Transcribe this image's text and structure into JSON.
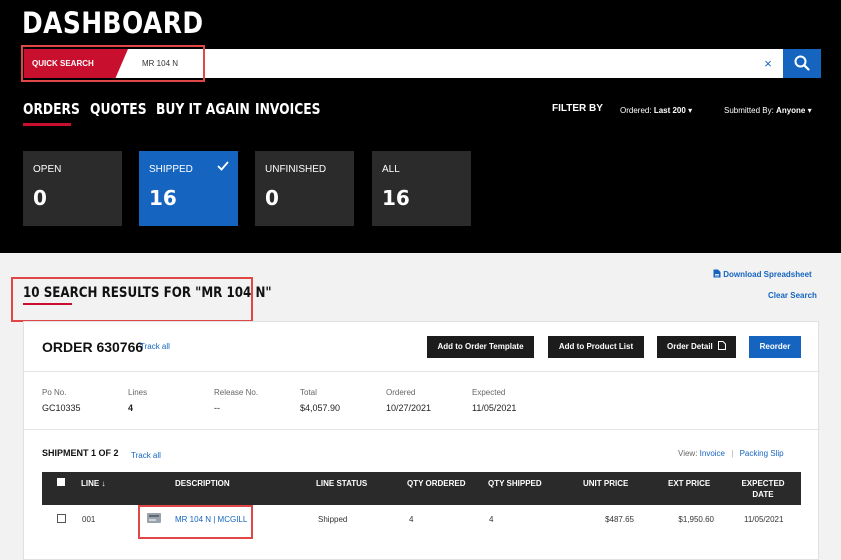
{
  "header": {
    "title": "DASHBOARD",
    "search": {
      "label": "QUICK SEARCH",
      "value": "MR 104 N",
      "clear_glyph": "×",
      "icon": "search-icon"
    }
  },
  "nav": {
    "tabs": [
      "ORDERS",
      "QUOTES",
      "BUY IT AGAIN",
      "INVOICES"
    ],
    "active": "ORDERS"
  },
  "filters": {
    "label": "FILTER BY",
    "ordered_label": "Ordered:",
    "ordered_value": "Last 200",
    "submitted_label": "Submitted By:",
    "submitted_value": "Anyone"
  },
  "status_cards": [
    {
      "label": "OPEN",
      "count": "0"
    },
    {
      "label": "SHIPPED",
      "count": "16",
      "active": true
    },
    {
      "label": "UNFINISHED",
      "count": "0"
    },
    {
      "label": "ALL",
      "count": "16"
    }
  ],
  "results": {
    "title": "10 SEARCH RESULTS FOR \"MR 104 N\"",
    "download_label": "Download Spreadsheet",
    "clear_label": "Clear Search"
  },
  "order": {
    "title": "ORDER 630766",
    "track_label": "Track all",
    "buttons": {
      "add_template": "Add to Order Template",
      "add_product_list": "Add to Product List",
      "order_detail": "Order Detail",
      "reorder": "Reorder"
    },
    "meta": [
      {
        "key": "Po No.",
        "value": "GC10335"
      },
      {
        "key": "Lines",
        "value": "4"
      },
      {
        "key": "Release No.",
        "value": "--"
      },
      {
        "key": "Total",
        "value": "$4,057.90"
      },
      {
        "key": "Ordered",
        "value": "10/27/2021"
      },
      {
        "key": "Expected",
        "value": "11/05/2021"
      }
    ]
  },
  "shipment": {
    "title": "SHIPMENT 1 OF 2",
    "track_label": "Track all",
    "view_label": "View:",
    "invoice_label": "Invoice",
    "packing_label": "Packing Slip",
    "columns": [
      "LINE ↓",
      "DESCRIPTION",
      "LINE STATUS",
      "QTY ORDERED",
      "QTY SHIPPED",
      "UNIT PRICE",
      "EXT PRICE",
      "EXPECTED",
      "DATE"
    ],
    "rows": [
      {
        "line": "001",
        "description": "MR 104 N | MCGILL",
        "status": "Shipped",
        "qty_ordered": "4",
        "qty_shipped": "4",
        "unit_price": "$487.65",
        "ext_price": "$1,950.60",
        "expected_date": "11/05/2021"
      }
    ]
  },
  "colors": {
    "brand_red": "#c8102e",
    "accent_blue": "#1565c0",
    "highlight": "#e04848"
  }
}
